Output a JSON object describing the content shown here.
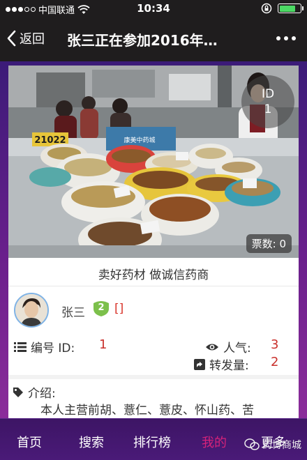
{
  "status_bar": {
    "carrier": "中国联通",
    "time": "10:34",
    "battery_color": "#4cd964"
  },
  "nav": {
    "back_label": "返回",
    "title": "张三正在参加2016年…"
  },
  "card": {
    "photo": {
      "sign_number": "21022",
      "id_label": "ID",
      "id_value": "1",
      "votes_label": "票数:",
      "votes_value": "0"
    },
    "slogan": "卖好药材 做诚信药商",
    "owner": {
      "name": "张三",
      "level": "2",
      "extra": "[]"
    },
    "stats": {
      "id_label": "编号 ID:",
      "id_value": "1",
      "popularity_label": "人气:",
      "popularity_value": "3",
      "shares_label": "转发量:",
      "shares_value": "2"
    },
    "intro": {
      "label": "介绍:",
      "text": "本人主营前胡、薏仁、薏皮、怀山药、苦"
    }
  },
  "tabs": [
    {
      "label": "首页",
      "active": false
    },
    {
      "label": "搜索",
      "active": false
    },
    {
      "label": "排行榜",
      "active": false
    },
    {
      "label": "我的",
      "active": true
    },
    {
      "label": "更多",
      "active": false
    }
  ],
  "watermark": "药博商城",
  "colors": {
    "accent_red": "#c9302c",
    "active_tab": "#d6227a",
    "level_badge": "#7cc04b"
  }
}
